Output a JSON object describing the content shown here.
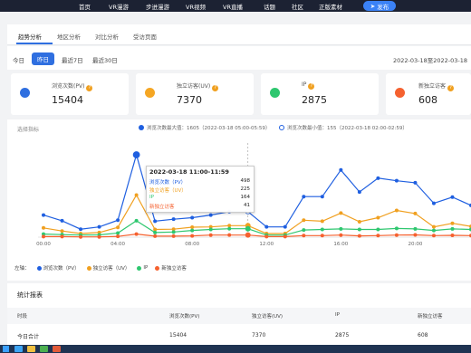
{
  "nav": {
    "items": [
      "首页",
      "VR漫游",
      "步进漫游",
      "VR视频",
      "VR直播",
      "话题",
      "社区",
      "正版素材"
    ],
    "publish_label": "发布"
  },
  "tabs": [
    "趋势分析",
    "地区分析",
    "对比分析",
    "受访页面"
  ],
  "filters": [
    "今日",
    "昨日",
    "最近7日",
    "最近30日"
  ],
  "date_range": "2022-03-18至2022-03-18",
  "cards": [
    {
      "label": "浏览次数(PV)",
      "value": "15404",
      "color": "#2f6fe0"
    },
    {
      "label": "独立访客(UV)",
      "value": "7370",
      "color": "#f5a623"
    },
    {
      "label": "IP",
      "value": "2875",
      "color": "#2ec76f"
    },
    {
      "label": "新独立访客",
      "value": "608",
      "color": "#f5612f"
    }
  ],
  "chart_panel": {
    "select_placeholder": "选择指标",
    "legend_max": "浏览次数最大值：1605（2022-03-18 05:00-05:59）",
    "legend_min": "浏览次数最小值：155（2022-03-18 02:00-02:59）",
    "bottom_legend_title": "左轴：",
    "series_labels": [
      "浏览次数（PV）",
      "独立访客（UV）",
      "IP",
      "新独立访客"
    ]
  },
  "chart_data": {
    "type": "line",
    "x": [
      "00:00",
      "01:00",
      "02:00",
      "03:00",
      "04:00",
      "05:00",
      "06:00",
      "07:00",
      "08:00",
      "09:00",
      "10:00",
      "11:00",
      "12:00",
      "13:00",
      "14:00",
      "15:00",
      "16:00",
      "17:00",
      "18:00",
      "19:00",
      "20:00",
      "21:00",
      "22:00",
      "23:00"
    ],
    "x_tick_labels": [
      "00:00",
      "04:00",
      "08:00",
      "12:00",
      "16:00",
      "20:00"
    ],
    "ylim": [
      0,
      1800
    ],
    "colors": [
      "#1f5fe0",
      "#f0a020",
      "#2ec76f",
      "#f5612f"
    ],
    "series": [
      {
        "name": "浏览次数（PV）",
        "values": [
          430,
          320,
          155,
          200,
          330,
          1605,
          310,
          350,
          380,
          430,
          498,
          498,
          200,
          200,
          790,
          790,
          1310,
          880,
          1150,
          1100,
          1060,
          660,
          780,
          620
        ]
      },
      {
        "name": "独立访客（UV）",
        "values": [
          180,
          120,
          70,
          90,
          190,
          820,
          150,
          155,
          195,
          200,
          225,
          225,
          70,
          70,
          330,
          310,
          470,
          300,
          380,
          520,
          460,
          200,
          270,
          210
        ]
      },
      {
        "name": "IP",
        "values": [
          60,
          50,
          40,
          45,
          80,
          320,
          90,
          100,
          130,
          150,
          164,
          164,
          40,
          40,
          140,
          150,
          160,
          150,
          150,
          170,
          160,
          130,
          160,
          150
        ]
      },
      {
        "name": "新独立访客",
        "values": [
          10,
          10,
          5,
          5,
          15,
          60,
          20,
          20,
          25,
          40,
          41,
          41,
          10,
          10,
          30,
          30,
          40,
          25,
          30,
          40,
          45,
          30,
          35,
          30
        ]
      }
    ]
  },
  "tooltip": {
    "title": "2022-03-18 11:00-11:59",
    "rows": [
      {
        "name": "浏览次数（PV）",
        "value": "498",
        "color": "#1f5fe0"
      },
      {
        "name": "独立访客（UV）",
        "value": "225",
        "color": "#f0a020"
      },
      {
        "name": "IP",
        "value": "164",
        "color": "#2ec76f"
      },
      {
        "name": "新独立访客",
        "value": "41",
        "color": "#f5612f"
      }
    ]
  },
  "table": {
    "title": "统计报表",
    "headers": [
      "时段",
      "浏览次数(PV)",
      "独立访客(UV)",
      "IP",
      "新独立访客"
    ],
    "rows": [
      [
        "今日合计",
        "15404",
        "7370",
        "2875",
        "608"
      ]
    ]
  }
}
